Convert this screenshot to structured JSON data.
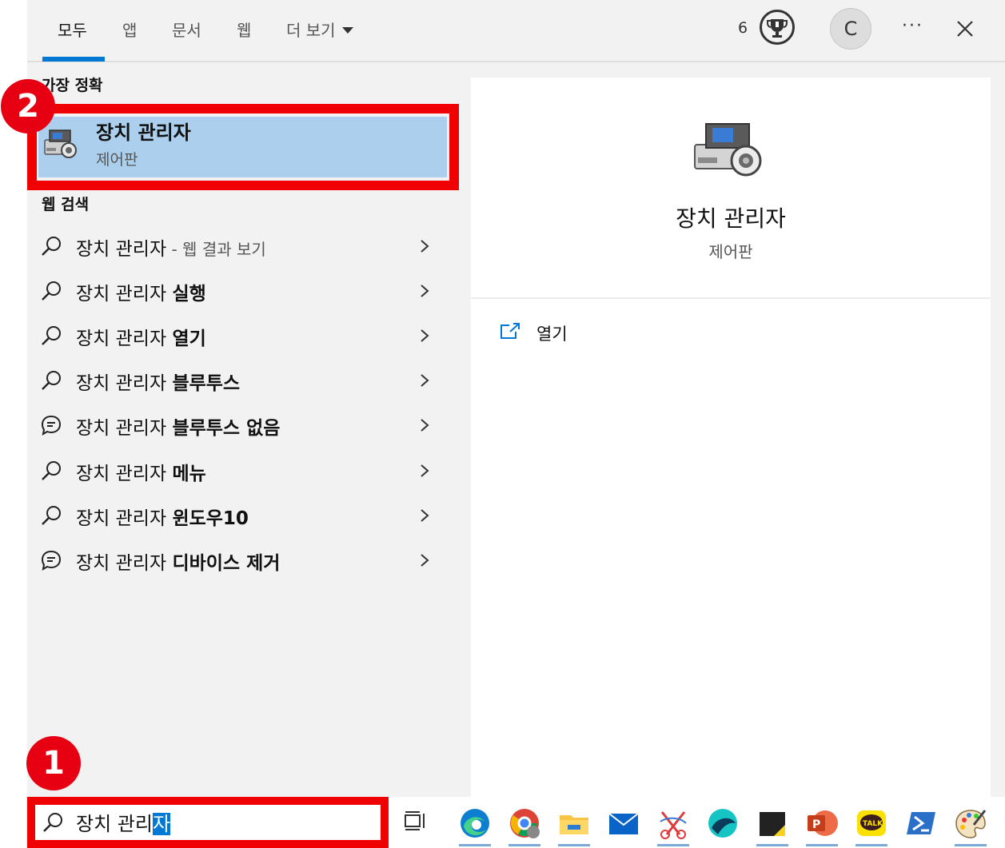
{
  "tabs": [
    {
      "label": "모두",
      "active": true
    },
    {
      "label": "앱"
    },
    {
      "label": "문서"
    },
    {
      "label": "웹"
    },
    {
      "label": "더 보기"
    }
  ],
  "header": {
    "rewards_count": "6",
    "avatar_initial": "C",
    "more_label": "···"
  },
  "best_match": {
    "section_label": "가장 정확",
    "title": "장치 관리자",
    "subtitle": "제어판"
  },
  "web_search": {
    "section_label": "웹 검색",
    "items": [
      {
        "prefix": "장치 관리자",
        "bold": "",
        "suffix": " - 웹 결과 보기",
        "icon": "search-icon"
      },
      {
        "prefix": "장치 관리자 ",
        "bold": "실행",
        "suffix": "",
        "icon": "search-icon"
      },
      {
        "prefix": "장치 관리자 ",
        "bold": "열기",
        "suffix": "",
        "icon": "search-icon"
      },
      {
        "prefix": "장치 관리자 ",
        "bold": "블루투스",
        "suffix": "",
        "icon": "search-icon"
      },
      {
        "prefix": "장치 관리자 ",
        "bold": "블루투스 없음",
        "suffix": "",
        "icon": "chat-icon"
      },
      {
        "prefix": "장치 관리자 ",
        "bold": "메뉴",
        "suffix": "",
        "icon": "search-icon"
      },
      {
        "prefix": "장치 관리자 ",
        "bold": "윈도우10",
        "suffix": "",
        "icon": "search-icon"
      },
      {
        "prefix": "장치 관리자 ",
        "bold": "디바이스 제거",
        "suffix": "",
        "icon": "chat-icon"
      }
    ]
  },
  "detail": {
    "title": "장치 관리자",
    "subtitle": "제어판",
    "open_label": "열기"
  },
  "search": {
    "query_plain": "장치 관리",
    "query_selected": "자"
  },
  "annotations": {
    "badge_1": "1",
    "badge_2": "2"
  },
  "taskbar_apps": [
    "edge-icon",
    "chrome-icon",
    "file-explorer-icon",
    "mail-icon",
    "snipping-tool-icon",
    "whale-browser-icon",
    "sticky-notes-icon",
    "powerpoint-icon",
    "kakaotalk-icon",
    "powershell-icon",
    "paint-icon"
  ],
  "kakaotalk_label": "TALK",
  "colors": {
    "accent": "#0078d4",
    "highlight_row": "#abcfec",
    "annotation_red": "#f00000",
    "badge_red": "#e60012"
  }
}
